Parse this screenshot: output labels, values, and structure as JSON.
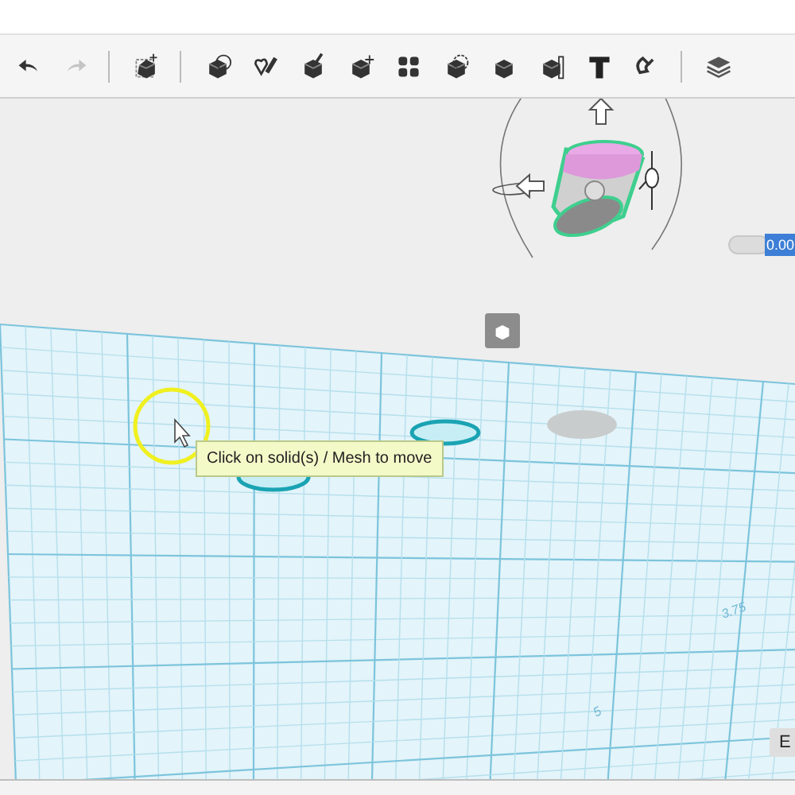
{
  "toolbar": {
    "history": [
      {
        "kind": "undo",
        "disabled": false
      },
      {
        "kind": "redo",
        "disabled": true
      }
    ]
  },
  "viewport": {
    "tooltip": "Click on solid(s) / Mesh to move",
    "value_field": {
      "value": "0.00"
    },
    "grid_labels": [
      "3.75",
      "5"
    ],
    "corner_button": "E"
  }
}
